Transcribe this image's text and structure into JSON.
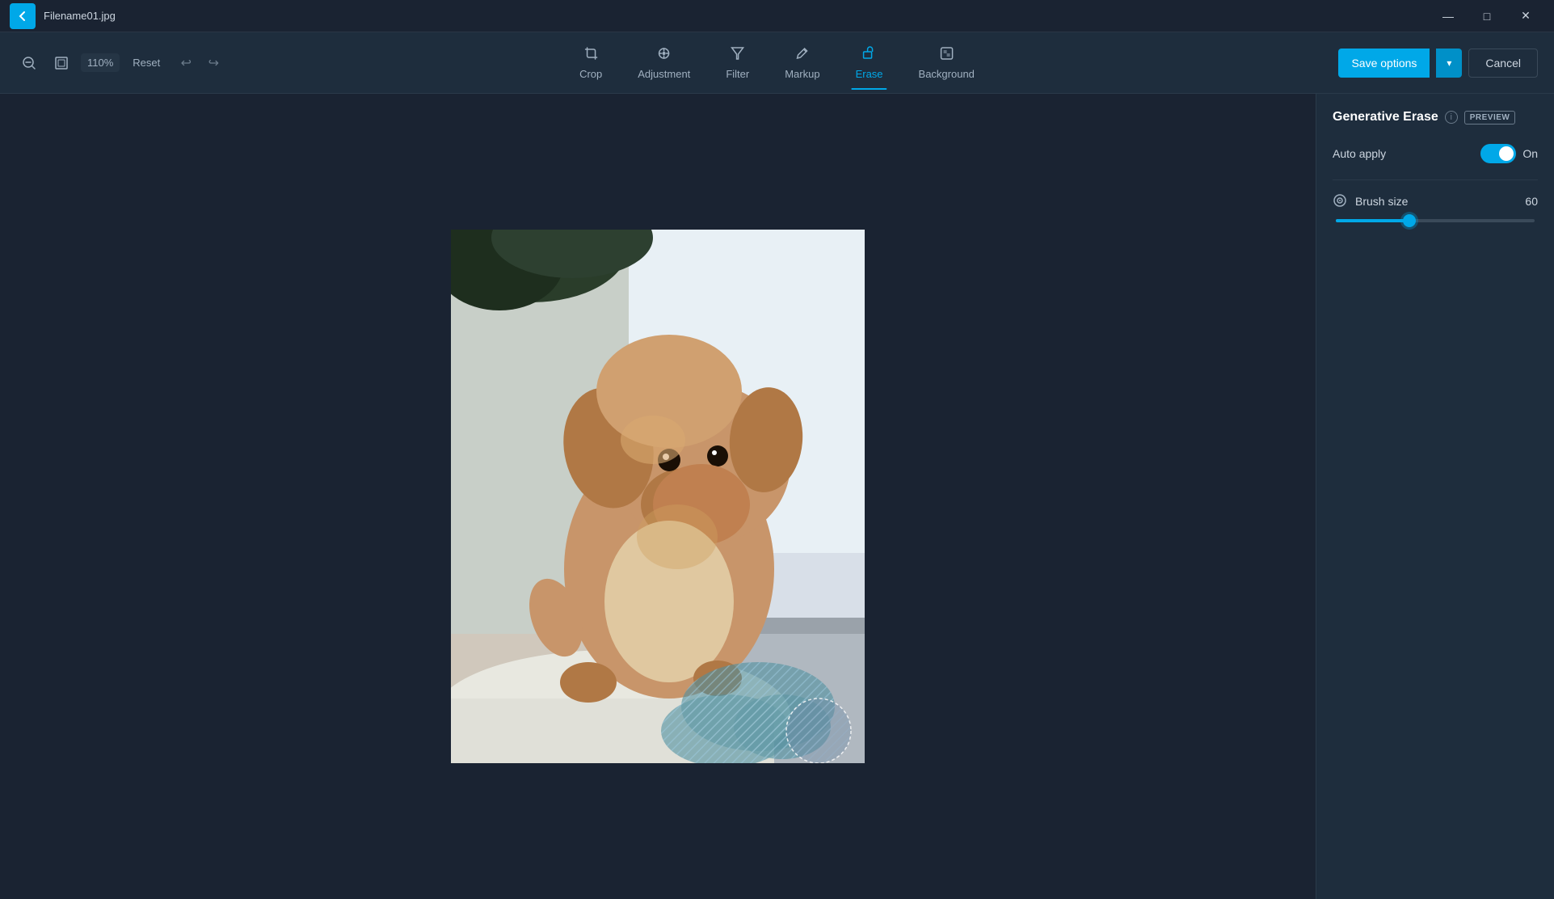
{
  "titlebar": {
    "filename": "Filename01.jpg",
    "back_label": "←",
    "minimize_label": "—",
    "maximize_label": "□",
    "close_label": "✕"
  },
  "toolbar": {
    "zoom_level": "110%",
    "reset_label": "Reset",
    "undo_label": "↩",
    "redo_label": "↪",
    "tools": [
      {
        "id": "crop",
        "label": "Crop",
        "icon": "⊡"
      },
      {
        "id": "adjustment",
        "label": "Adjustment",
        "icon": "✦"
      },
      {
        "id": "filter",
        "label": "Filter",
        "icon": "⊿"
      },
      {
        "id": "markup",
        "label": "Markup",
        "icon": "✏"
      },
      {
        "id": "erase",
        "label": "Erase",
        "icon": "◈",
        "active": true
      },
      {
        "id": "background",
        "label": "Background",
        "icon": "⊞"
      }
    ],
    "save_options_label": "Save options",
    "cancel_label": "Cancel"
  },
  "panel": {
    "title": "Generative Erase",
    "preview_badge": "PREVIEW",
    "auto_apply_label": "Auto apply",
    "toggle_state": "On",
    "brush_size_label": "Brush size",
    "brush_size_value": "60",
    "slider_percent": 37
  },
  "colors": {
    "accent": "#00a8e8",
    "background": "#1a2332",
    "panel_bg": "#1e2d3d"
  }
}
